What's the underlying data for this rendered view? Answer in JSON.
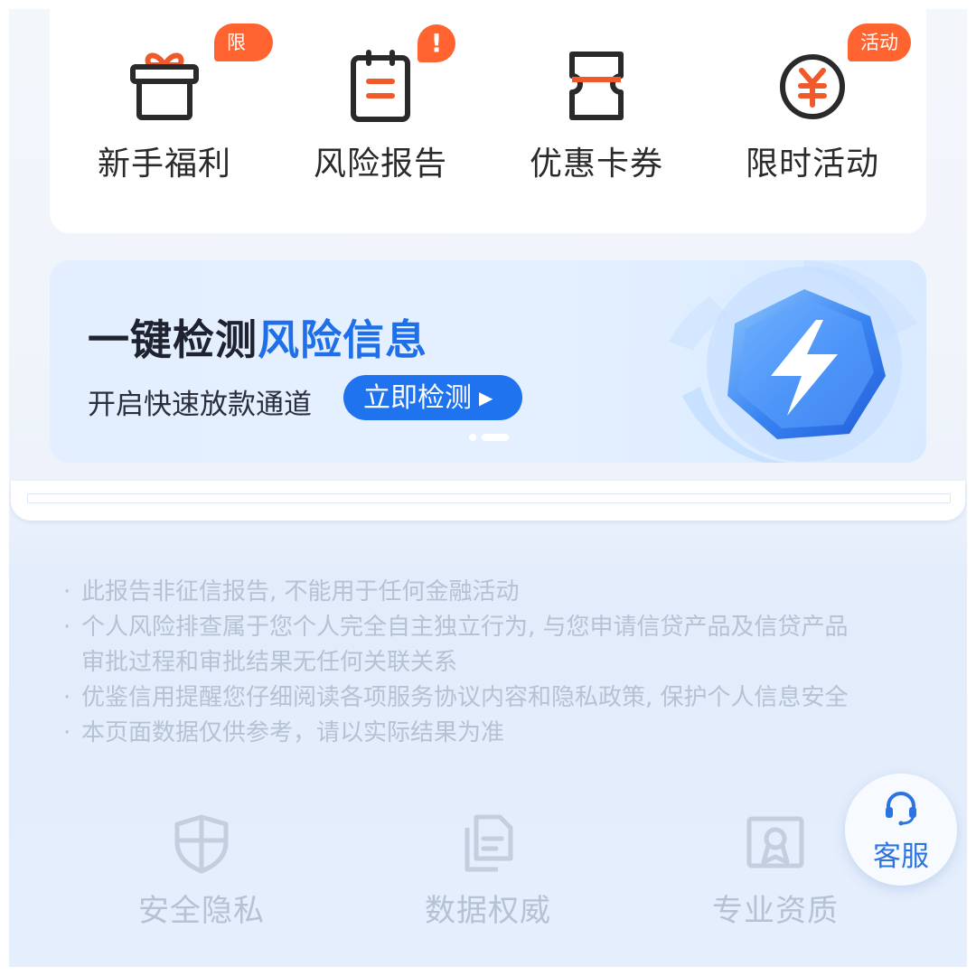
{
  "quick_actions": [
    {
      "label": "新手福利",
      "icon": "gift-icon",
      "badge": "限时"
    },
    {
      "label": "风险报告",
      "icon": "clipboard-report-icon",
      "badge": "!"
    },
    {
      "label": "优惠卡券",
      "icon": "coupon-ticket-icon",
      "badge": ""
    },
    {
      "label": "限时活动",
      "icon": "yuan-coin-icon",
      "badge": "活动"
    }
  ],
  "banner": {
    "title_part1": "一键检测",
    "title_part2": "风险信息",
    "subtitle": "开启快速放款通道",
    "button_label": "立即检测",
    "art_icon": "lightning-icon",
    "carousel_total": 2,
    "carousel_active": 2
  },
  "disclaimer": [
    "此报告非征信报告, 不能用于任何金融活动",
    "个人风险排查属于您个人完全自主独立行为, 与您申请信贷产品及信贷产品",
    "审批过程和审批结果无任何关联关系",
    "优鉴信用提醒您仔细阅读各项服务协议内容和隐私政策, 保护个人信息安全",
    "本页面数据仅供参考，请以实际结果为准"
  ],
  "features": [
    {
      "label": "安全隐私",
      "icon": "shield-icon"
    },
    {
      "label": "数据权威",
      "icon": "documents-icon"
    },
    {
      "label": "专业资质",
      "icon": "certificate-icon"
    }
  ],
  "customer_service": {
    "label": "客服",
    "icon": "headset-icon"
  },
  "colors": {
    "accent_blue": "#1f73ee",
    "badge_orange": "#ff6430",
    "muted_text": "#b5c2d4"
  }
}
